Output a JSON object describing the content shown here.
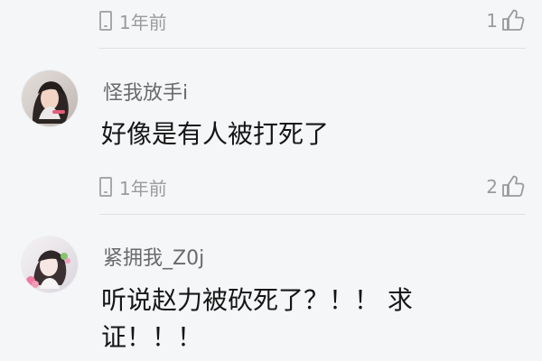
{
  "icons": {
    "device": "phone-icon",
    "like": "thumb-up-icon"
  },
  "comments": [
    {
      "time": "1年前",
      "likes": "1"
    },
    {
      "username": "怪我放手i",
      "text": "好像是有人被打死了",
      "time": "1年前",
      "likes": "2"
    },
    {
      "username": "紧拥我_Z0j",
      "text": "听说赵力被砍死了？！！ 求证！！！"
    }
  ]
}
